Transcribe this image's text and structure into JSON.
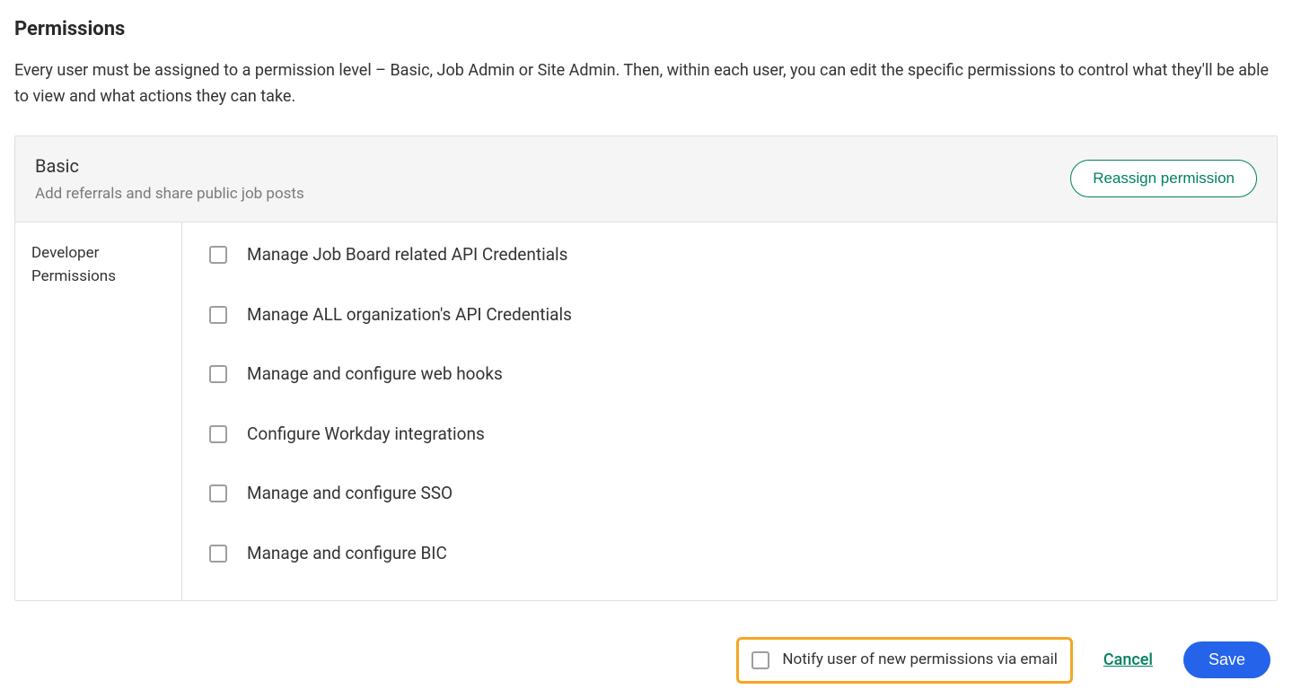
{
  "header": {
    "title": "Permissions",
    "description": "Every user must be assigned to a permission level – Basic, Job Admin or Site Admin. Then, within each user, you can edit the specific permissions to control what they'll be able to view and what actions they can take."
  },
  "panel": {
    "title": "Basic",
    "subtitle": "Add referrals and share public job posts",
    "reassign_label": "Reassign permission"
  },
  "sidebar": {
    "section_label": "Developer Permissions"
  },
  "permissions": [
    {
      "label": "Manage Job Board related API Credentials",
      "checked": false
    },
    {
      "label": "Manage ALL organization's API Credentials",
      "checked": false
    },
    {
      "label": "Manage and configure web hooks",
      "checked": false
    },
    {
      "label": "Configure Workday integrations",
      "checked": false
    },
    {
      "label": "Manage and configure SSO",
      "checked": false
    },
    {
      "label": "Manage and configure BIC",
      "checked": false
    }
  ],
  "footer": {
    "notify_label": "Notify user of new permissions via email",
    "notify_checked": false,
    "cancel_label": "Cancel",
    "save_label": "Save"
  }
}
